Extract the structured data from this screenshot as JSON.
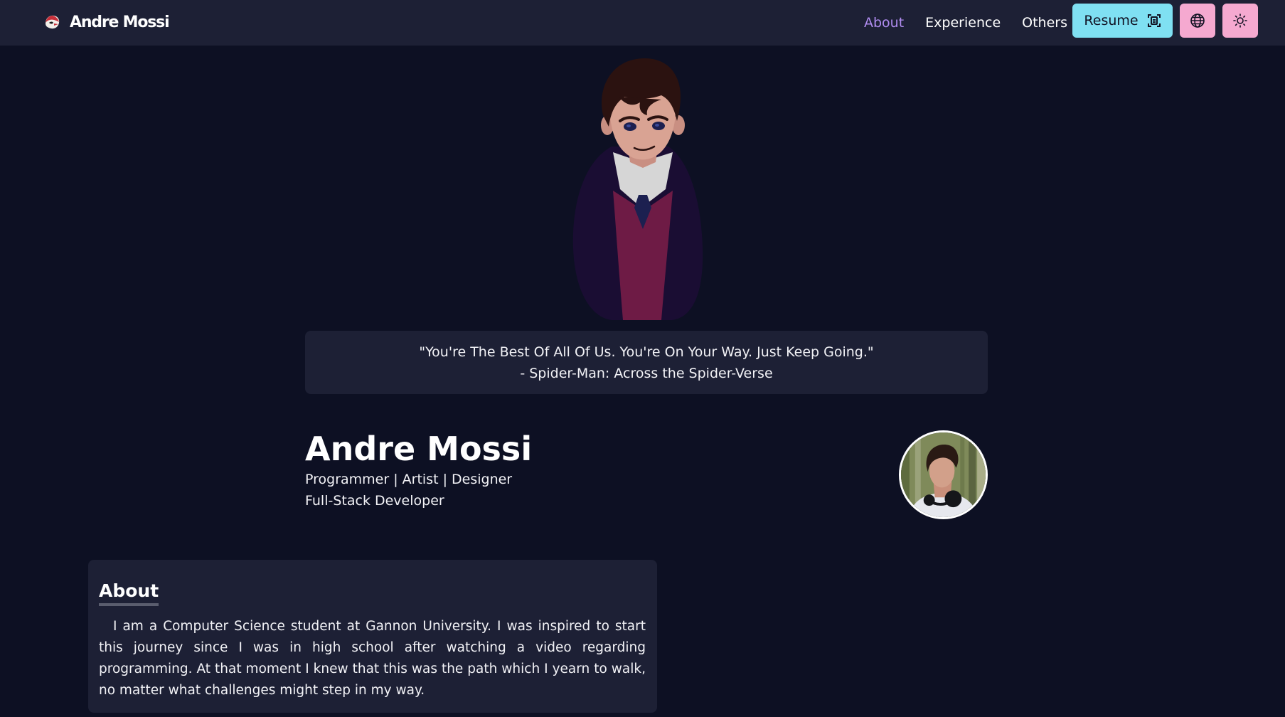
{
  "navbar": {
    "brand": "Andre Mossi",
    "links": [
      "About",
      "Experience",
      "Others"
    ],
    "active_link": "About",
    "resume_label": "Resume",
    "resume_icon": "document-scan-icon",
    "language_icon": "globe-icon",
    "theme_icon": "sun-icon",
    "colors": {
      "background": "#1d2035",
      "active_link": "#b08cf0",
      "resume_button": "#7fe0f2",
      "icon_buttons": "#f5a9d0"
    }
  },
  "quote": {
    "text": "\"You're The Best Of All Of Us. You're On Your Way. Just Keep Going.\"",
    "source": "- Spider-Man: Across the Spider-Verse"
  },
  "hero": {
    "name": "Andre Mossi",
    "roles": "Programmer | Artist | Designer",
    "title": "Full-Stack Developer"
  },
  "about": {
    "heading": "About",
    "text": "I am a Computer Science student at Gannon University. I was inspired to start this journey since I was in high school after watching a video regarding programming. At that moment I knew that this was the path which I yearn to walk, no matter what challenges might step in my way."
  },
  "colors": {
    "page_background": "#0d1023",
    "card_background": "#1d2035"
  }
}
